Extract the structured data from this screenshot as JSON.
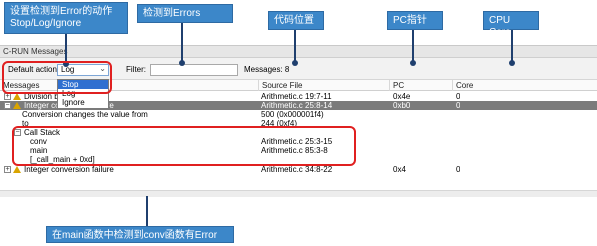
{
  "callouts": {
    "action": "设置检测到Error的动作\nStop/Log/Ignore",
    "errors": "检测到Errors",
    "code": "代码位置",
    "pc": "PC指针",
    "cpu": "CPU Core",
    "bottom": "在main函数中检测到conv函数有Error"
  },
  "window": {
    "title": "C-RUN Messages"
  },
  "toolbar": {
    "default_action_label": "Default action:",
    "default_action_value": "Log",
    "filter_label": "Filter:",
    "filter_value": "",
    "messages_label": "Messages: 8"
  },
  "dropdown_options": [
    "Stop",
    "Log",
    "Ignore"
  ],
  "columns": [
    "Messages",
    "Source File",
    "PC",
    "Core"
  ],
  "rows": [
    {
      "msg": "Division b",
      "src": "Arithmetic.c 19:7-11",
      "pc": "0x4e",
      "core": "0"
    },
    {
      "msg": "Integer conversion failure",
      "src": "Arithmetic.c 25:8-14",
      "pc": "0xb0",
      "core": "0"
    },
    {
      "msg": "Conversion changes the value from",
      "src": "500 (0x000001f4)",
      "pc": "",
      "core": ""
    },
    {
      "msg": "to",
      "src": "244 (0xf4)",
      "pc": "",
      "core": ""
    },
    {
      "msg": "Call Stack",
      "src": "",
      "pc": "",
      "core": ""
    },
    {
      "msg": "conv",
      "src": "Arithmetic.c 25:3-15",
      "pc": "",
      "core": ""
    },
    {
      "msg": "main",
      "src": "Arithmetic.c 85:3-8",
      "pc": "",
      "core": ""
    },
    {
      "msg": "[_call_main + 0xd]",
      "src": "",
      "pc": "",
      "core": ""
    },
    {
      "msg": "Integer conversion failure",
      "src": "Arithmetic.c 34:8-22",
      "pc": "0x4",
      "core": "0"
    }
  ],
  "colors": {
    "callout_bg": "#3c87c9",
    "highlight_red": "#e02020",
    "selected_row": "#7b7b7b",
    "dropdown_selected": "#2f6fd0"
  },
  "icons": [
    "warning-icon",
    "expand-icon",
    "collapse-icon",
    "chevron-down-icon"
  ]
}
